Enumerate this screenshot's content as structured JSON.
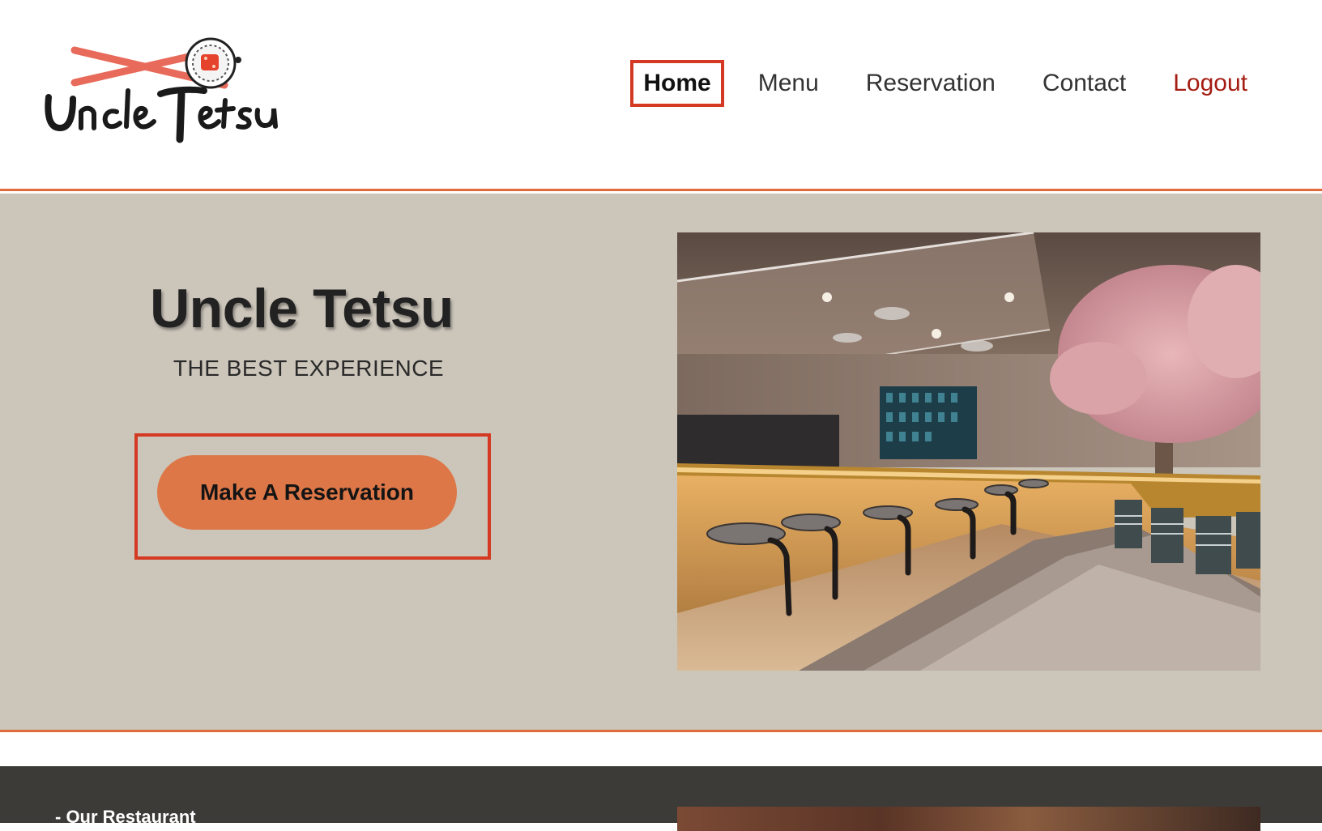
{
  "brand": {
    "logo_alt": "Uncle Tetsu logo",
    "logo_text": "Uncle Tetsu"
  },
  "nav": {
    "items": [
      {
        "label": "Home",
        "active": true
      },
      {
        "label": "Menu",
        "active": false
      },
      {
        "label": "Reservation",
        "active": false
      },
      {
        "label": "Contact",
        "active": false
      },
      {
        "label": "Logout",
        "active": false
      }
    ]
  },
  "hero": {
    "title": "Uncle Tetsu",
    "subtitle": "THE BEST EXPERIENCE",
    "cta_label": "Make A Reservation",
    "image_alt": "Restaurant interior with counter seating and a cherry blossom tree"
  },
  "about": {
    "section_label": "- Our Restaurant"
  },
  "colors": {
    "accent": "#e06a3c",
    "cta": "#de7748",
    "hero_bg": "#cbc5ba",
    "highlight": "#d43a23",
    "logout": "#a41d13",
    "dark_section": "#3d3b38"
  }
}
